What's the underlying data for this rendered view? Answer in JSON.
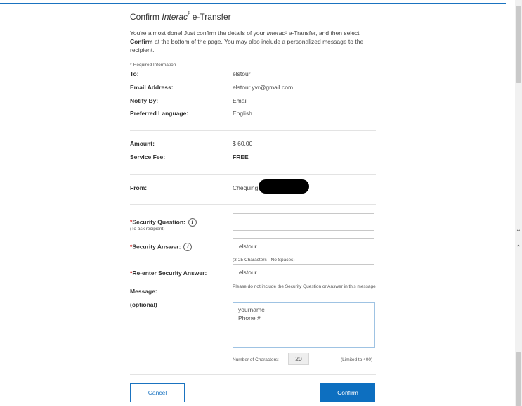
{
  "header": {
    "title_prefix": "Confirm",
    "title_brand": "Interac",
    "title_mark": "‡",
    "title_suffix": "e-Transfer"
  },
  "intro": {
    "part1": "You're almost done! Just confirm the details of your",
    "brand": "Interac",
    "mark": "‡",
    "part2": "e-Transfer, and then select",
    "confirm_word": "Confirm",
    "part3": "at the bottom of the page. You may also include a personalized message to the recipient."
  },
  "required_note": "*-Required Information",
  "recipient": {
    "to_label": "To:",
    "to_value": "elstour",
    "email_label": "Email Address:",
    "email_value": "elstour.yvr@gmail.com",
    "notify_label": "Notify By:",
    "notify_value": "Email",
    "lang_label": "Preferred Language:",
    "lang_value": "English"
  },
  "payment": {
    "amount_label": "Amount:",
    "amount_value": "$ 60.00",
    "fee_label": "Service Fee:",
    "fee_value": "FREE",
    "from_label": "From:",
    "from_value": "Chequing"
  },
  "security": {
    "asterisk": "*",
    "question_label": "Security Question:",
    "question_sub": "(To ask recipient)",
    "question_value": "",
    "answer_label": "Security Answer:",
    "answer_value": "elstour",
    "answer_hint": "(3-25 Characters - No Spaces)",
    "reenter_label": "Re-enter Security Answer:",
    "reenter_value": "elstour",
    "info_glyph": "i"
  },
  "message": {
    "label": "Message:",
    "optional": "(optional)",
    "hint": "Please do not include the Security Question or Answer in this message",
    "value": "yourname\nPhone #",
    "count_label": "Number of Characters:",
    "count_value": "20",
    "limit": "(Limited to 400)"
  },
  "buttons": {
    "cancel": "Cancel",
    "confirm": "Confirm"
  },
  "scroll": {
    "down_icon": "⌄",
    "up_icon": "⌃"
  },
  "colors": {
    "accent": "#0d6fc0",
    "required": "#cc0000"
  }
}
